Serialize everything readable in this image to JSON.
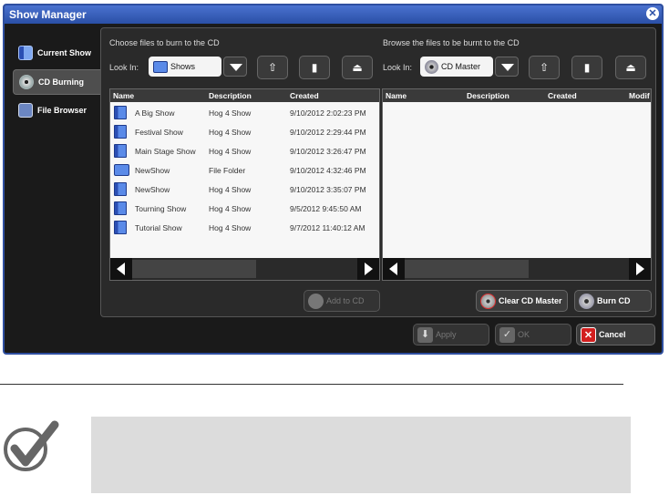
{
  "window": {
    "title": "Show Manager"
  },
  "sidebar": {
    "items": [
      {
        "label": "Current Show",
        "icon": "show-book-icon",
        "active": false
      },
      {
        "label": "CD Burning",
        "icon": "cd-disc-icon",
        "active": true
      },
      {
        "label": "File Browser",
        "icon": "file-browser-icon",
        "active": false
      }
    ]
  },
  "left": {
    "heading": "Choose files to burn to the CD",
    "lookin_label": "Look In:",
    "lookin_value": "Shows",
    "columns": [
      "Name",
      "Description",
      "Created"
    ],
    "rows": [
      {
        "name": "A Big Show",
        "description": "Hog 4 Show",
        "created": "9/10/2012 2:02:23 PM",
        "icon": "show-book-icon"
      },
      {
        "name": "Festival Show",
        "description": "Hog 4 Show",
        "created": "9/10/2012 2:29:44 PM",
        "icon": "show-book-icon"
      },
      {
        "name": "Main Stage Show",
        "description": "Hog 4 Show",
        "created": "9/10/2012 3:26:47 PM",
        "icon": "show-book-icon"
      },
      {
        "name": "NewShow",
        "description": "File Folder",
        "created": "9/10/2012 4:32:46 PM",
        "icon": "folder-icon"
      },
      {
        "name": "NewShow",
        "description": "Hog 4 Show",
        "created": "9/10/2012 3:35:07 PM",
        "icon": "show-book-icon"
      },
      {
        "name": "Tourning Show",
        "description": "Hog 4 Show",
        "created": "9/5/2012 9:45:50 AM",
        "icon": "show-book-icon"
      },
      {
        "name": "Tutorial Show",
        "description": "Hog 4 Show",
        "created": "9/7/2012 11:40:12 AM",
        "icon": "show-book-icon"
      }
    ],
    "add_button": "Add to CD"
  },
  "right": {
    "heading": "Browse the files to be burnt to the CD",
    "lookin_label": "Look In:",
    "lookin_value": "CD Master",
    "columns": [
      "Name",
      "Description",
      "Created",
      "Modif"
    ],
    "clear_button": "Clear CD Master",
    "burn_button": "Burn CD"
  },
  "footer": {
    "apply": "Apply",
    "ok": "OK",
    "cancel": "Cancel"
  },
  "colors": {
    "titlebar": "#2a4fa6",
    "cancel_red": "#d21f1f"
  }
}
